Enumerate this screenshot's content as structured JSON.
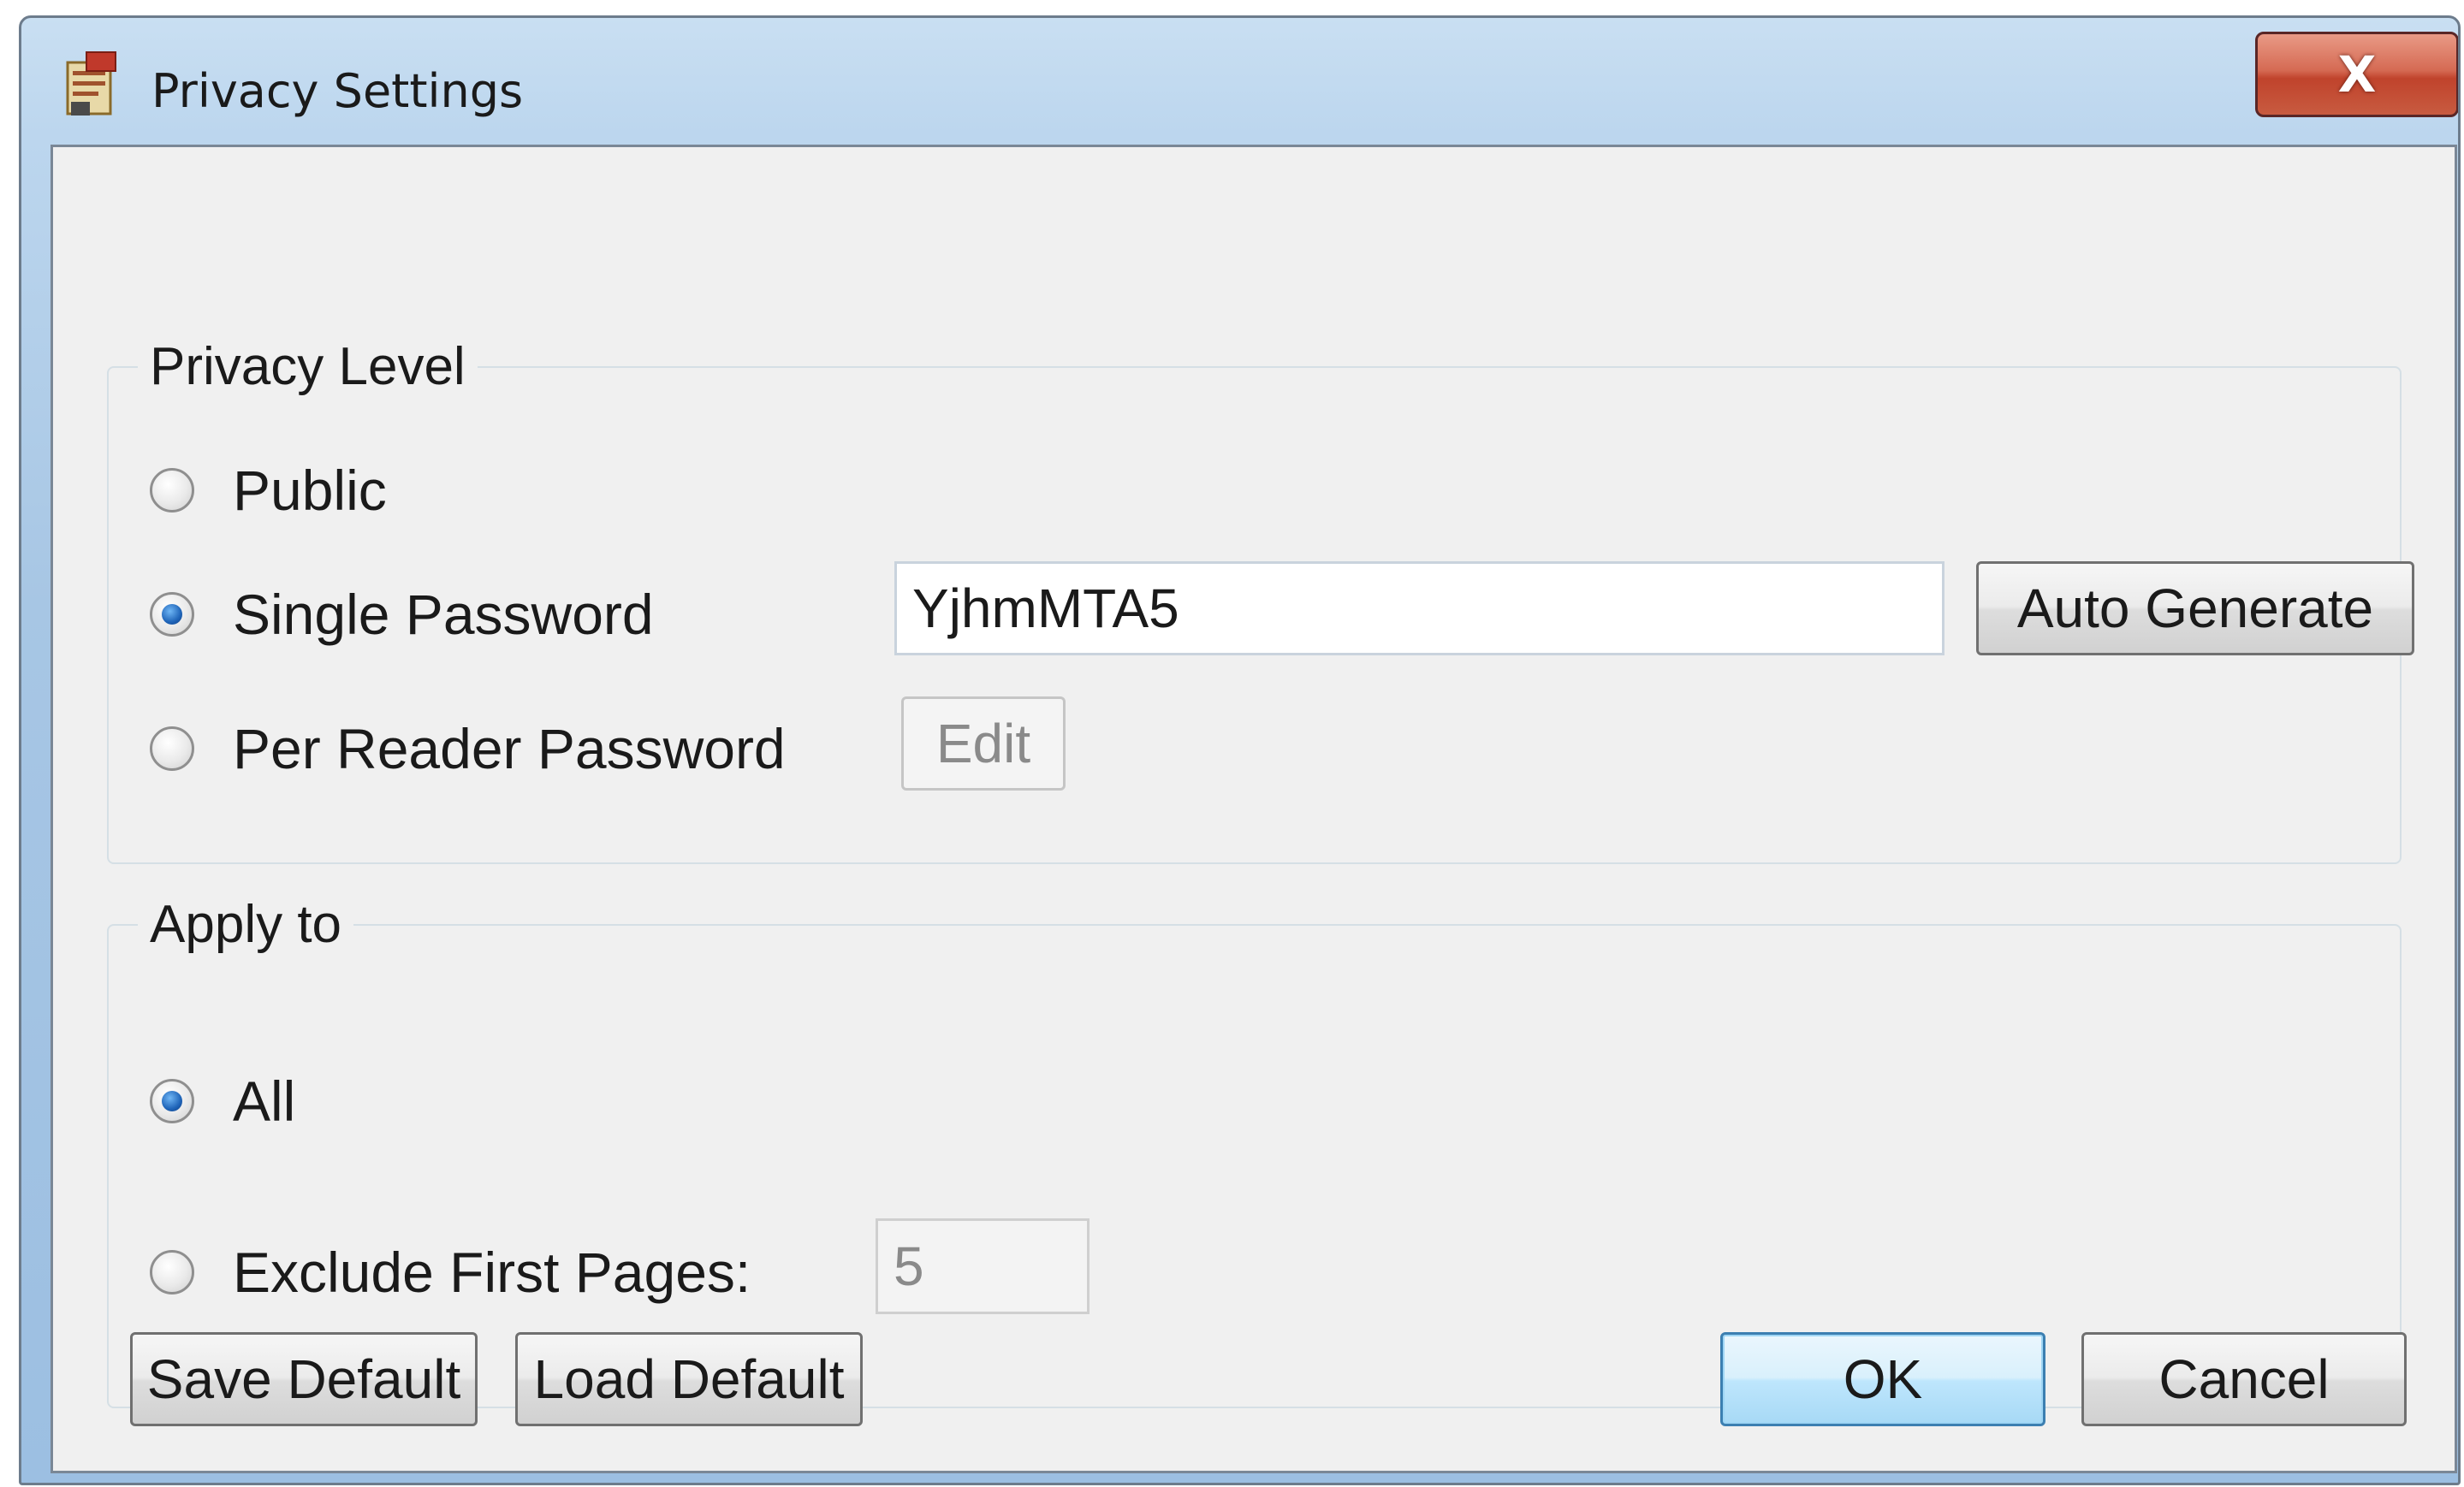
{
  "window": {
    "title": "Privacy Settings",
    "icon": "document-lock-icon",
    "close_label": "X"
  },
  "privacy_level": {
    "label": "Privacy Level",
    "options": [
      {
        "label": "Public",
        "checked": false
      },
      {
        "label": "Single Password",
        "checked": true
      },
      {
        "label": "Per Reader Password",
        "checked": false
      }
    ],
    "password_value": "YjhmMTA5",
    "auto_generate_label": "Auto Generate",
    "edit_label": "Edit",
    "edit_enabled": false
  },
  "apply_to": {
    "label": "Apply to",
    "options": [
      {
        "label": "All",
        "checked": true
      },
      {
        "label": "Exclude First Pages:",
        "checked": false
      }
    ],
    "pages_value": "5",
    "pages_enabled": false
  },
  "footer": {
    "save_default_label": "Save Default",
    "load_default_label": "Load Default",
    "ok_label": "OK",
    "cancel_label": "Cancel"
  },
  "colors": {
    "title_gradient": "#bcd6ee",
    "client_bg": "#f0f0f0",
    "close_button": "#c8553d",
    "default_button_border": "#3c7fb1"
  }
}
